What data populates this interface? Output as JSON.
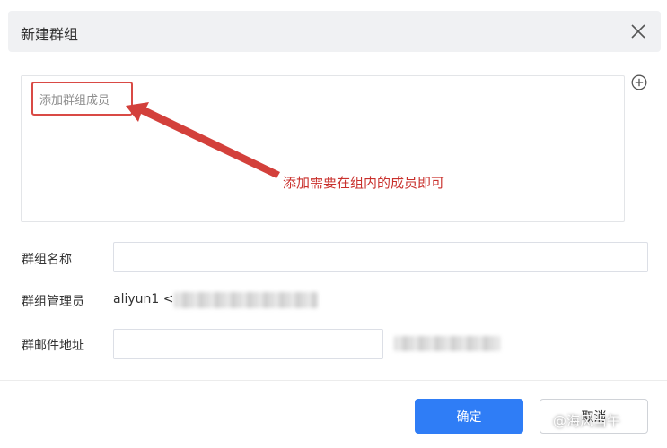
{
  "dialog": {
    "title": "新建群组",
    "members_placeholder": "添加群组成员",
    "annotation": "添加需要在组内的成员即可",
    "form": {
      "group_name_label": "群组名称",
      "group_name_value": "",
      "admin_label": "群组管理员",
      "admin_value": "aliyun1 <",
      "email_label": "群邮件地址",
      "email_value": ""
    },
    "buttons": {
      "confirm": "确定",
      "cancel": "取消"
    },
    "watermark": "@海风当午"
  },
  "colors": {
    "primary": "#2f7df6",
    "annotation": "#c9312d",
    "header_bg": "#f0f1f3"
  },
  "icons": {
    "close": "close-icon",
    "add": "add-circle-icon"
  }
}
